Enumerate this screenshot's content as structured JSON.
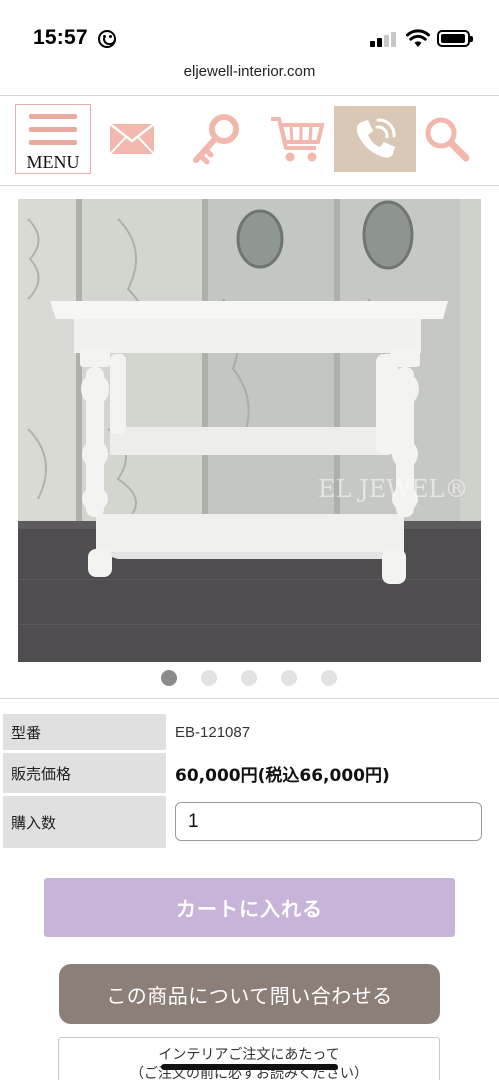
{
  "status_bar": {
    "time": "15:57"
  },
  "browser": {
    "url": "eljewell-interior.com"
  },
  "nav": {
    "menu_label": "MENU"
  },
  "product": {
    "watermark": "EL JEWEL®",
    "image_count": 5,
    "active_image": 1
  },
  "spec": {
    "model_label": "型番",
    "model_value": "EB-121087",
    "price_label": "販売価格",
    "price_value": "60,000円(税込66,000円)",
    "qty_label": "購入数",
    "qty_value": "1"
  },
  "actions": {
    "cart_label": "カートに入れる",
    "inquiry_label": "この商品について問い合わせる"
  },
  "notice": {
    "line1": "インテリアご注文にあたって",
    "line2": "（ご注文の前に必ずお読みください）"
  },
  "colors": {
    "accent_pink": "#e9aaa0",
    "phone_box": "#d9c8b5",
    "cart_button": "#c7b4d8",
    "inquiry_button": "#8c7f78"
  }
}
